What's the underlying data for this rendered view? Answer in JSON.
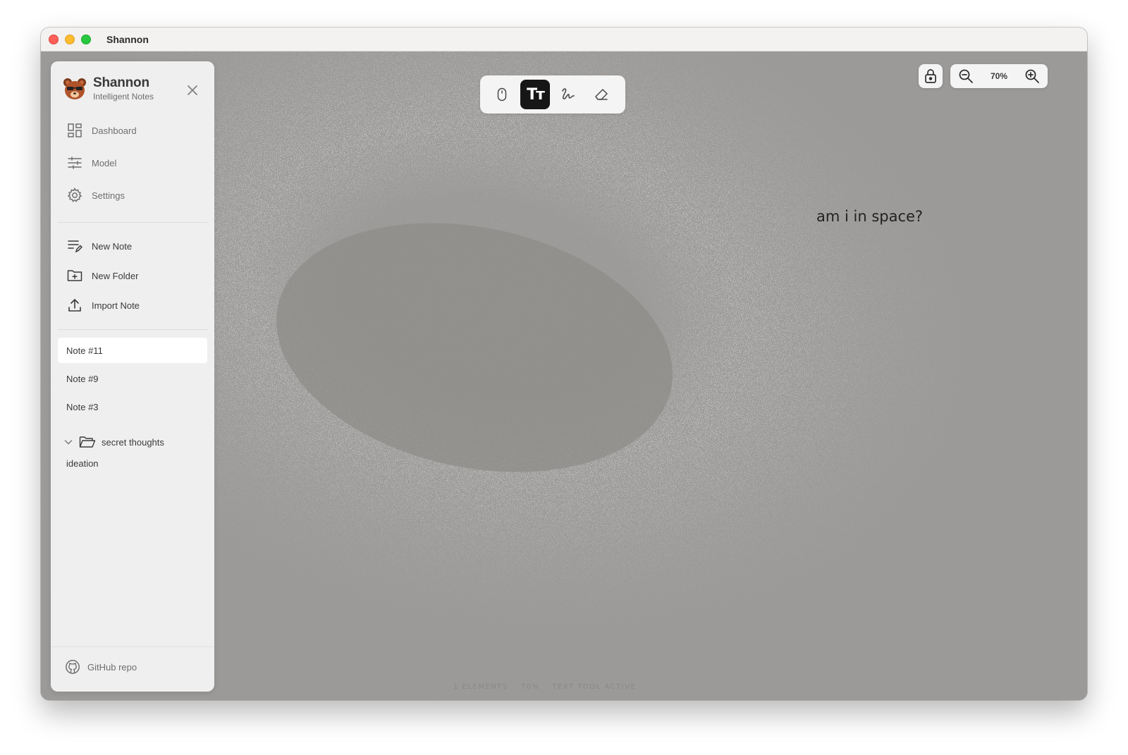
{
  "window": {
    "title": "Shannon"
  },
  "sidebar": {
    "brand_name": "Shannon",
    "brand_sub": "Intelligent Notes",
    "nav": [
      {
        "label": "Dashboard",
        "icon": "dashboard-icon"
      },
      {
        "label": "Model",
        "icon": "sliders-icon"
      },
      {
        "label": "Settings",
        "icon": "gear-icon"
      }
    ],
    "actions": [
      {
        "label": "New Note",
        "icon": "new-note-icon"
      },
      {
        "label": "New Folder",
        "icon": "new-folder-icon"
      },
      {
        "label": "Import Note",
        "icon": "upload-icon"
      }
    ],
    "notes": [
      {
        "label": "Note #11",
        "active": true
      },
      {
        "label": "Note #9"
      },
      {
        "label": "Note #3"
      }
    ],
    "folder": {
      "label": "secret thoughts",
      "expanded": true
    },
    "folder_child": "ideation",
    "footer_label": "GitHub repo"
  },
  "toolbar": {
    "tools": [
      "select-tool",
      "text-tool",
      "draw-tool",
      "eraser-tool"
    ],
    "active_tool": "text-tool",
    "text_glyph": "Tт"
  },
  "zoom": {
    "level": "70%"
  },
  "canvas": {
    "text": "am i in space?"
  },
  "status": {
    "elements": "1 ELEMENTS",
    "zoom": "70%",
    "tool": "TEXT TOOL ACTIVE"
  },
  "colors": {
    "canvas_bg": "#9c9a98",
    "active_tool_bg": "#161616",
    "sidebar_bg": "#efefef"
  }
}
